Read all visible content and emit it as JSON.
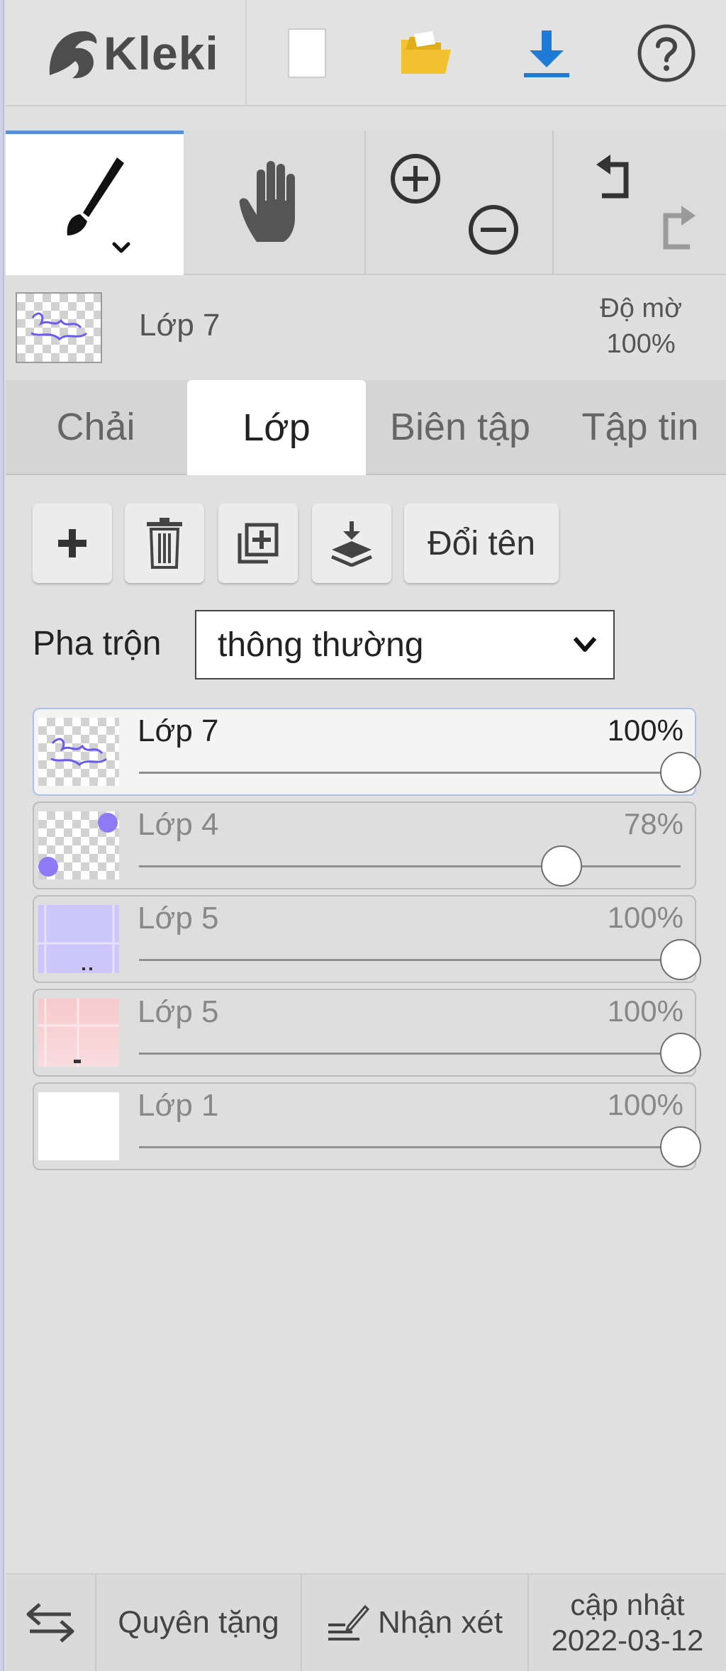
{
  "app": {
    "name": "Kleki"
  },
  "topbar": {
    "icons": [
      "new-file-icon",
      "open-folder-icon",
      "download-icon",
      "help-icon"
    ],
    "download_color": "#1e7bd6",
    "folder_color": "#f2c230"
  },
  "tools": {
    "active": "brush",
    "items": [
      "brush-icon",
      "hand-icon",
      "zoom-in-icon",
      "zoom-out-icon",
      "undo-icon",
      "redo-icon"
    ]
  },
  "current_layer": {
    "name": "Lớp 7",
    "opacity_label": "Độ mờ",
    "opacity_value": "100%"
  },
  "tabs": [
    {
      "label": "Chải"
    },
    {
      "label": "Lớp",
      "active": true
    },
    {
      "label": "Biên tập"
    },
    {
      "label": "Tập tin"
    }
  ],
  "layer_toolbar": {
    "icons": [
      "add-layer-icon",
      "delete-layer-icon",
      "duplicate-layer-icon",
      "merge-down-icon"
    ],
    "rename_label": "Đổi tên"
  },
  "blend": {
    "label": "Pha trộn",
    "value": "thông thường"
  },
  "layers": [
    {
      "name": "Lớp 7",
      "opacity": "100%",
      "level": 1.0,
      "selected": true
    },
    {
      "name": "Lớp 4",
      "opacity": "78%",
      "level": 0.78
    },
    {
      "name": "Lớp 5",
      "opacity": "100%",
      "level": 1.0
    },
    {
      "name": "Lớp 5",
      "opacity": "100%",
      "level": 1.0
    },
    {
      "name": "Lớp 1",
      "opacity": "100%",
      "level": 1.0
    }
  ],
  "bottombar": {
    "donate_label": "Quyên tặng",
    "feedback_label": "Nhận xét",
    "update_label": "cập nhật",
    "update_date": "2022-03-12"
  },
  "colors": {
    "accent": "#5a8fd6",
    "selected_border": "#a9c1ea"
  }
}
